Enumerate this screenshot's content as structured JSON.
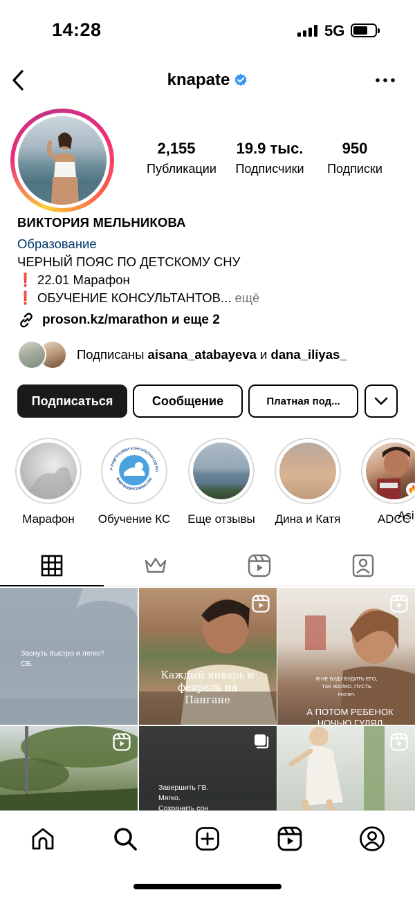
{
  "status_bar": {
    "time": "14:28",
    "network": "5G",
    "signal_icon": "cellular-signal-icon",
    "battery_icon": "battery-icon"
  },
  "header": {
    "username": "knapate",
    "back_icon": "chevron-left-icon",
    "verified_icon": "verified-badge-icon",
    "more_icon": "more-horizontal-icon"
  },
  "profile": {
    "stats": [
      {
        "value": "2,155",
        "label": "Публикации"
      },
      {
        "value": "19.9 тыс.",
        "label": "Подписчики"
      },
      {
        "value": "950",
        "label": "Подписки"
      }
    ],
    "name": "ВИКТОРИЯ МЕЛЬНИКОВА",
    "category": "Образование",
    "bio_line1": "ЧЕРНЫЙ ПОЯС ПО ДЕТСКОМУ СНУ",
    "bio_line2_mark": "❗",
    "bio_line2": "22.01 Марафон",
    "bio_line3_mark": "❗",
    "bio_line3": "ОБУЧЕНИЕ КОНСУЛЬТАНТОВ...",
    "bio_more": "ещё",
    "link": "proson.kz/marathon и еще 2",
    "link_icon": "link-icon"
  },
  "followed_by": {
    "prefix": "Подписаны",
    "user1": "aisana_atabayeva",
    "conjunction": "и",
    "user2": "dana_iliyas_"
  },
  "actions": {
    "follow": "Подписаться",
    "message": "Сообщение",
    "subscribe": "Платная под...",
    "dropdown_icon": "chevron-down-icon"
  },
  "highlights": [
    {
      "label": "Марафон"
    },
    {
      "label": "Обучение КС",
      "logo_text": "ЦЕНТР ПОДГОТОВКИ КОНСУЛЬТАНТОВ ПО СНУ",
      "logo_url": "BABYSLEEPCONSULT.RU"
    },
    {
      "label": "Еще отзывы"
    },
    {
      "label": "Дина и Катя"
    },
    {
      "label": "ADCC"
    },
    {
      "label": "Asi"
    }
  ],
  "tabs": [
    {
      "name": "grid-tab",
      "icon": "grid-icon",
      "active": true
    },
    {
      "name": "subscriptions-tab",
      "icon": "crown-icon",
      "active": false
    },
    {
      "name": "reels-tab",
      "icon": "reels-icon",
      "active": false
    },
    {
      "name": "tagged-tab",
      "icon": "tagged-user-icon",
      "active": false
    }
  ],
  "posts": [
    {
      "caption": "Заснуть быстро и легко?\nСБ.",
      "type": "image"
    },
    {
      "caption": "Каждый январь и\nфевраль на Пангане",
      "type": "reel"
    },
    {
      "caption_small": "Я НЕ БУДУ БУДИТЬ ЕГО,\nТАК ЖАЛКО. ПУСТЬ\nпоспит.",
      "caption": "А ПОТОМ РЕБЕНОК\nНОЧЬЮ ГУЛЯЛ",
      "type": "reel"
    },
    {
      "caption": "",
      "type": "reel"
    },
    {
      "caption": "Завершить ГВ.\nМягко.\nСохранить сон",
      "type": "carousel"
    },
    {
      "caption": "",
      "type": "reel"
    }
  ],
  "bottom_nav": [
    {
      "name": "nav-home",
      "icon": "home-icon"
    },
    {
      "name": "nav-search",
      "icon": "search-icon"
    },
    {
      "name": "nav-create",
      "icon": "create-post-icon"
    },
    {
      "name": "nav-reels",
      "icon": "reels-icon"
    },
    {
      "name": "nav-profile",
      "icon": "profile-icon"
    }
  ],
  "colors": {
    "category": "#00376b",
    "verified": "#3897f0",
    "muted": "#737373",
    "primary_button": "#1a1a1a"
  }
}
